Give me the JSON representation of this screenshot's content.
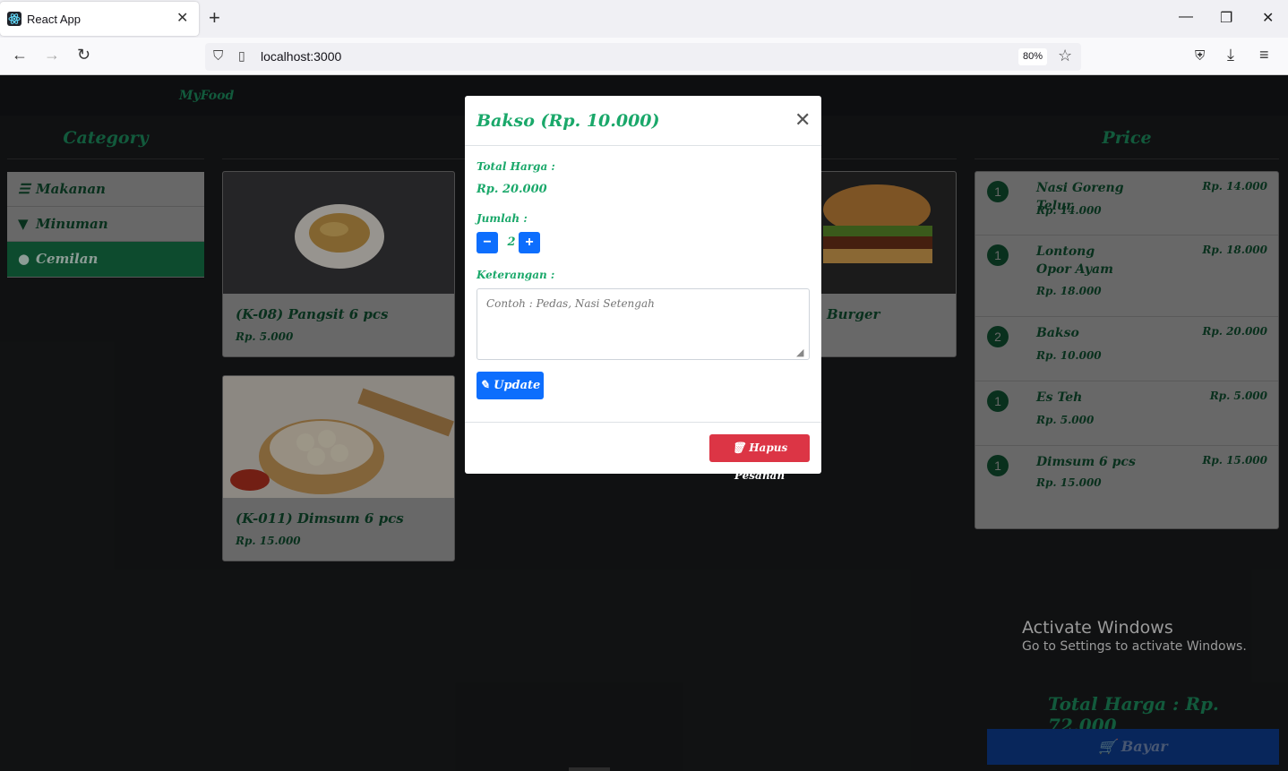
{
  "browser": {
    "tab_title": "React App",
    "url": "localhost:3000",
    "zoom": "80%"
  },
  "app": {
    "brand": "MyFood",
    "category_title": "Category",
    "price_title": "Price",
    "categories": [
      {
        "label": "Makanan",
        "icon": "burger-icon"
      },
      {
        "label": "Minuman",
        "icon": "glass-icon"
      },
      {
        "label": "Cemilan",
        "icon": "cookie-icon",
        "active": true
      }
    ],
    "products": [
      {
        "name": "(K-08) Pangsit 6 pcs",
        "price": "Rp. 5.000"
      },
      {
        "name": "Burger",
        "price": ""
      },
      {
        "name": "(K-011) Dimsum 6 pcs",
        "price": "Rp. 15.000"
      }
    ],
    "orders": [
      {
        "qty": "1",
        "name": "Nasi Goreng Telur",
        "sub": "Rp. 14.000",
        "total": "Rp. 14.000"
      },
      {
        "qty": "1",
        "name": "Lontong Opor Ayam",
        "sub": "Rp. 18.000",
        "total": "Rp. 18.000"
      },
      {
        "qty": "2",
        "name": "Bakso",
        "sub": "Rp. 10.000",
        "total": "Rp. 20.000"
      },
      {
        "qty": "1",
        "name": "Es Teh",
        "sub": "Rp. 5.000",
        "total": "Rp. 5.000"
      },
      {
        "qty": "1",
        "name": "Dimsum 6 pcs",
        "sub": "Rp. 15.000",
        "total": "Rp. 15.000"
      }
    ],
    "total_label": "Total Harga : Rp. 72.000",
    "pay_label": "Bayar"
  },
  "modal": {
    "title": "Bakso (Rp. 10.000)",
    "total_label": "Total Harga :",
    "total_value": "Rp. 20.000",
    "qty_label": "Jumlah :",
    "qty_value": "2",
    "note_label": "Keterangan :",
    "note_placeholder": "Contoh : Pedas, Nasi Setengah",
    "update_label": "Update",
    "delete_label": "Hapus Pesanan"
  },
  "system": {
    "activate_title": "Activate Windows",
    "activate_sub": "Go to Settings to activate Windows."
  },
  "colors": {
    "accent_green": "#1aa86a",
    "primary_blue": "#0d6efd",
    "danger_red": "#dc3545"
  }
}
